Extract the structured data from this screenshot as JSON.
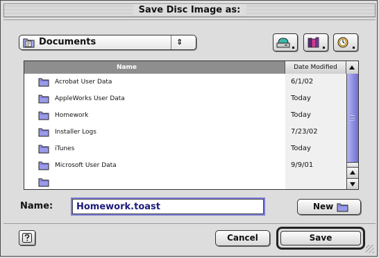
{
  "window": {
    "title": "Save Disc Image as:"
  },
  "location": {
    "folder_name": "Documents",
    "icon": "documents-folder-icon"
  },
  "toolbar": {
    "buttons": [
      {
        "icon": "disk-shortcuts-icon"
      },
      {
        "icon": "favorites-icon"
      },
      {
        "icon": "recent-items-icon"
      }
    ]
  },
  "file_list": {
    "columns": [
      "Name",
      "Date Modified"
    ],
    "rows": [
      {
        "name": "Acrobat User Data",
        "date": "6/1/02",
        "icon": "folder-icon"
      },
      {
        "name": "AppleWorks User Data",
        "date": "Today",
        "icon": "folder-icon"
      },
      {
        "name": "Homework",
        "date": "Today",
        "icon": "folder-icon"
      },
      {
        "name": "Installer Logs",
        "date": "7/23/02",
        "icon": "folder-icon"
      },
      {
        "name": "iTunes",
        "date": "Today",
        "icon": "folder-icon"
      },
      {
        "name": "Microsoft User Data",
        "date": "9/9/01",
        "icon": "folder-icon"
      },
      {
        "name": "",
        "date": "",
        "icon": "folder-icon"
      }
    ],
    "scroll_position": 0.0
  },
  "name_field": {
    "label": "Name:",
    "value": "Homework.toast"
  },
  "buttons": {
    "new_label": "New",
    "cancel_label": "Cancel",
    "save_label": "Save"
  },
  "colors": {
    "accent": "#7b7bd9",
    "folder": "#9a9ae8",
    "header_dark": "#8e8e8e"
  }
}
